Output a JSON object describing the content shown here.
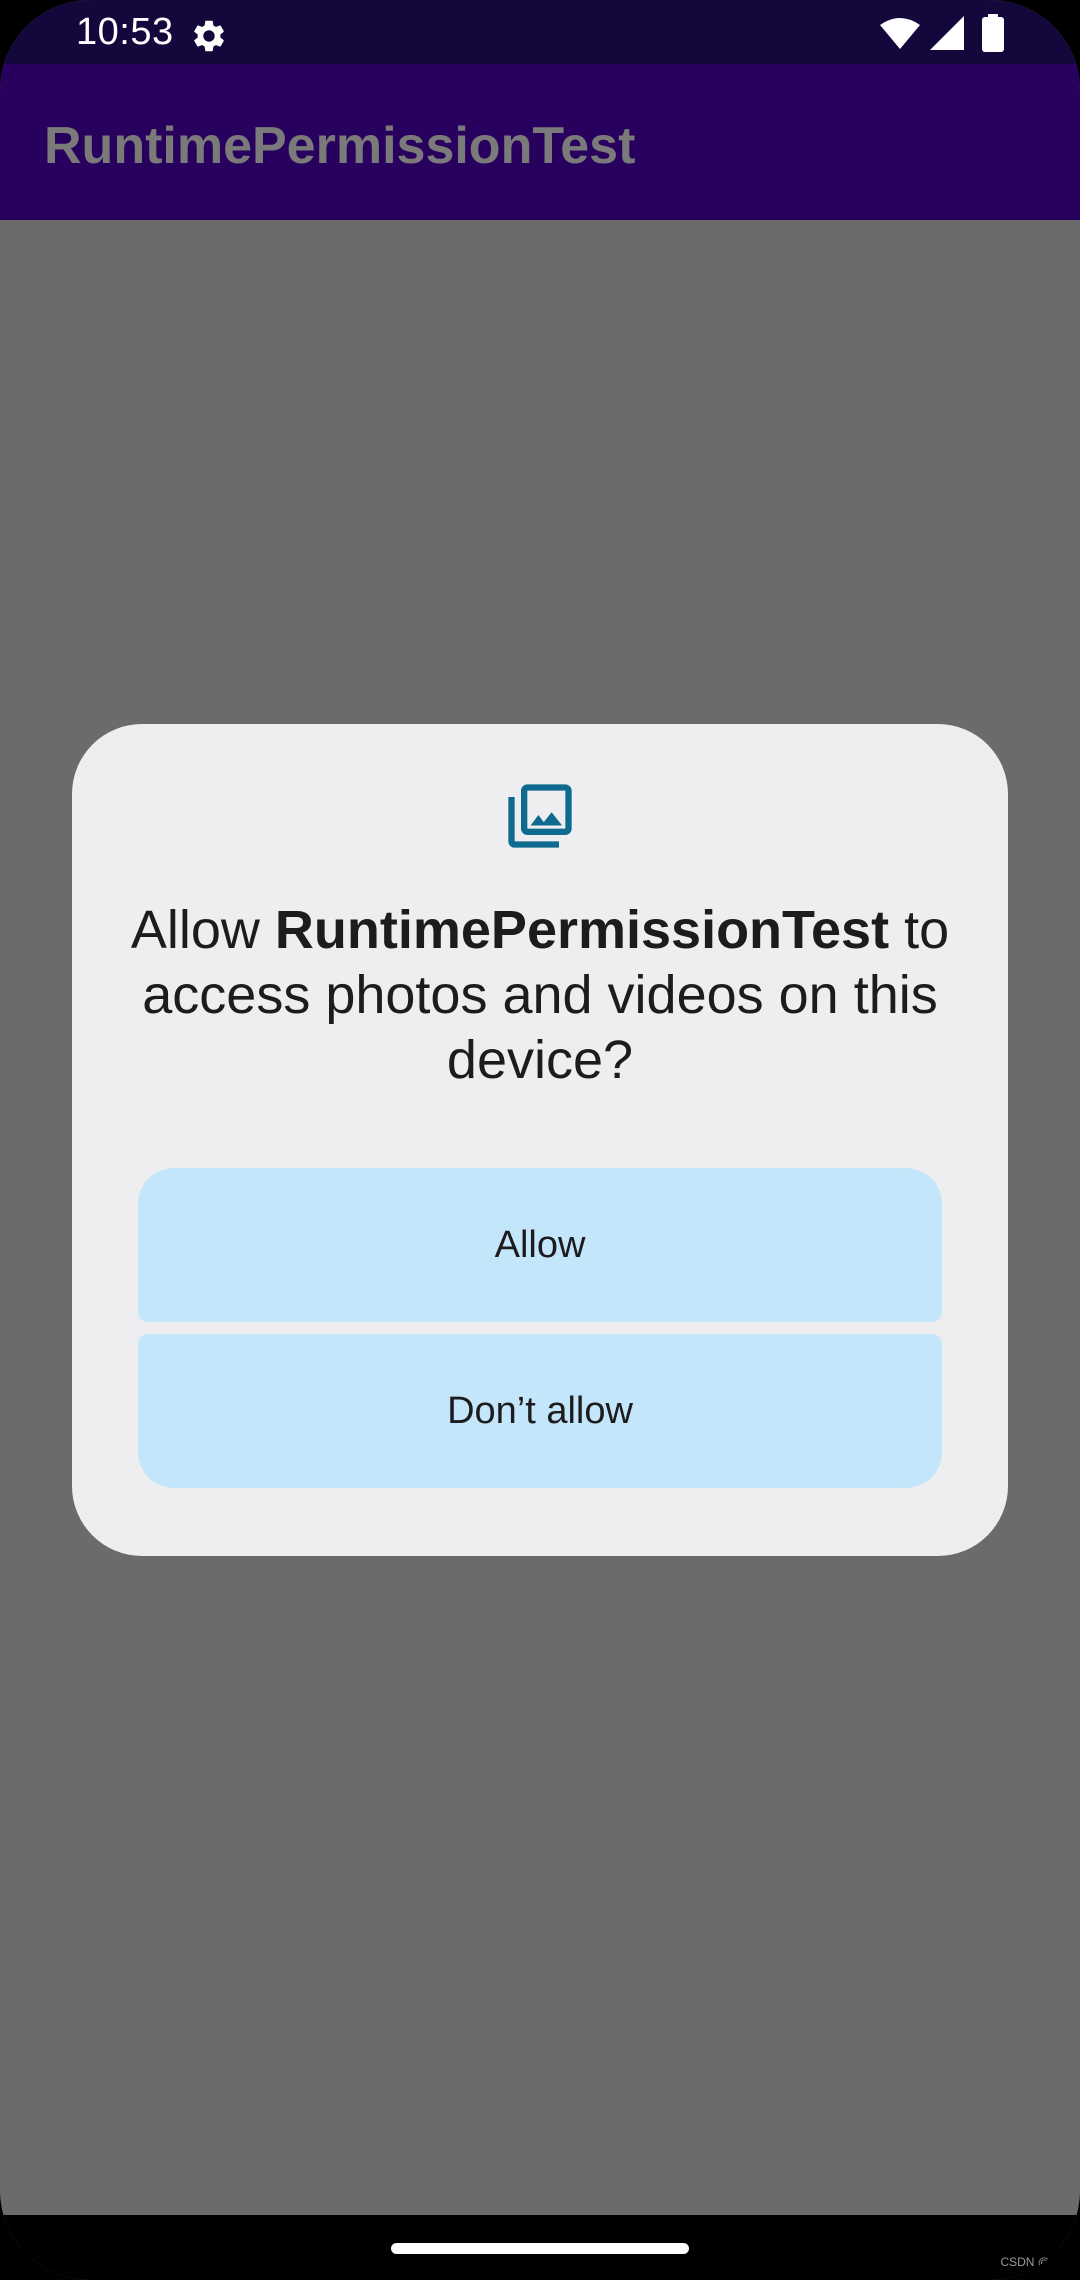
{
  "status_bar": {
    "time": "10:53",
    "icons": [
      "gear-icon",
      "wifi-icon",
      "signal-icon",
      "battery-icon"
    ]
  },
  "app_bar": {
    "title": "RuntimePermissionTest"
  },
  "dialog": {
    "icon": "photo-library-icon",
    "message_prefix": "Allow ",
    "app_name": "RuntimePermissionTest",
    "message_suffix": " to access photos and videos on this device?",
    "allow_label": "Allow",
    "deny_label": "Don’t allow"
  },
  "nav_bar": {
    "watermark": "CSDN @"
  },
  "colors": {
    "status_bar_bg": "#14073c",
    "app_bar_bg": "#28005e",
    "scrim": "#6b6b6b",
    "dialog_bg": "#eeeef0",
    "button_bg": "#c4e6fa",
    "icon_accent": "#0f6a8f"
  }
}
